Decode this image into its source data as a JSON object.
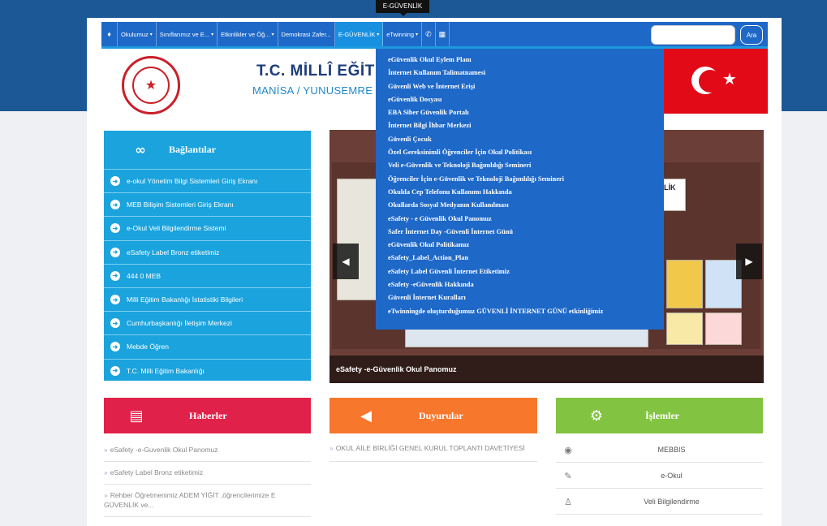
{
  "tooltip": "E-GÜVENLİK",
  "nav": {
    "items": [
      {
        "label": "Okulumuz",
        "caret": "▾"
      },
      {
        "label": "Sınıflarımız ve E...",
        "caret": "▾"
      },
      {
        "label": "Etkinlikler ve Öğ...",
        "caret": "▾"
      },
      {
        "label": "Demokrasi Zafer...",
        "caret": ""
      },
      {
        "label": "E-GÜVENLİK",
        "caret": "▾"
      },
      {
        "label": "eTwinning",
        "caret": "▾"
      }
    ],
    "search_placeholder": "",
    "search_button": "Ara"
  },
  "header": {
    "title": "T.C. MİLLÎ EĞİT",
    "subtitle": "MANİSA / YUNUSEMRE"
  },
  "links": {
    "title": "Bağlantılar",
    "icon": "link-icon",
    "items": [
      "e-okul Yönetim Bilgi Sistemleri Giriş Ekranı",
      "MEB Bilişim Sistemleri Giriş Ekranı",
      "e-Okul Veli Bilgilendirme Sistemi",
      "eSafety Label Bronz etiketimiz",
      "444 0 MEB",
      "Milli Eğitim Bakanlığı İstatistiki Bilgileri",
      "Cumhurbaşkanlığı İletişim Merkezi",
      "Mebde Öğren",
      "T.C. Milli Eğitim Bakanlığı"
    ]
  },
  "slider": {
    "caption": "eSafety -e-Güvenlik Okul Panomuz",
    "prev": "◀",
    "next": "▶",
    "partial_text": "LİK"
  },
  "dropdown": [
    "eGüvenlik Okul Eylem Planı",
    "İnternet Kullanım Talimatnamesi",
    "Güvenli Web ve İnternet Erişi",
    "eGüvenlik Dosyası",
    "EBA Siber Güvenlik Portalı",
    "İnternet Bilgi İhbar Merkezi",
    "Güvenli Çocuk",
    "Özel Gereksinimli Öğrenciler İçin Okul Politikası",
    "Veli e-Güvenlik ve Teknoloji Bağımlılığı Semineri",
    "Öğrenciler İçin e-Güvenlik ve Teknoloji Bağımlılığı Semineri",
    "Okulda Cep Telefonu Kullanımı Hakkında",
    "Okullarda Sosyal Medyanın Kullanılması",
    "eSafety - e Güvenlik Okul Panomuz",
    "Safer İnternet Day -Güvenli İnternet Günü",
    "eGüvenlik Okul Politikamız",
    "eSafety_Label_Action_Plan",
    "eSafety Label Güvenli İnternet Etiketimiz",
    "eSafety -eGüvenlik Hakkında",
    "Güvenli İnternet Kuralları",
    "eTwinningde oluşturduğumuz GÜVENLİ İNTERNET GÜNÜ etkinliğimiz"
  ],
  "news": {
    "title": "Haberler",
    "items": [
      "eSafety -e-Guvenlik Okul Panomuz",
      "eSafety Label Bronz etiketimiz",
      "Rehber Öğretmenimiz ADEM YİĞİT ,öğrencilerimize E GÜVENLİK ve..."
    ]
  },
  "announcements": {
    "title": "Duyurular",
    "items": [
      "OKUL AİLE BİRLİĞİ GENEL KURUL TOPLANTI DAVETİYESİ"
    ]
  },
  "operations": {
    "title": "İşlemler",
    "items": [
      {
        "label": "MEBBIS",
        "icon": "mebbis-icon"
      },
      {
        "label": "e-Okul",
        "icon": "eokul-icon"
      },
      {
        "label": "Veli Bilgilendirme",
        "icon": "family-icon"
      }
    ]
  }
}
